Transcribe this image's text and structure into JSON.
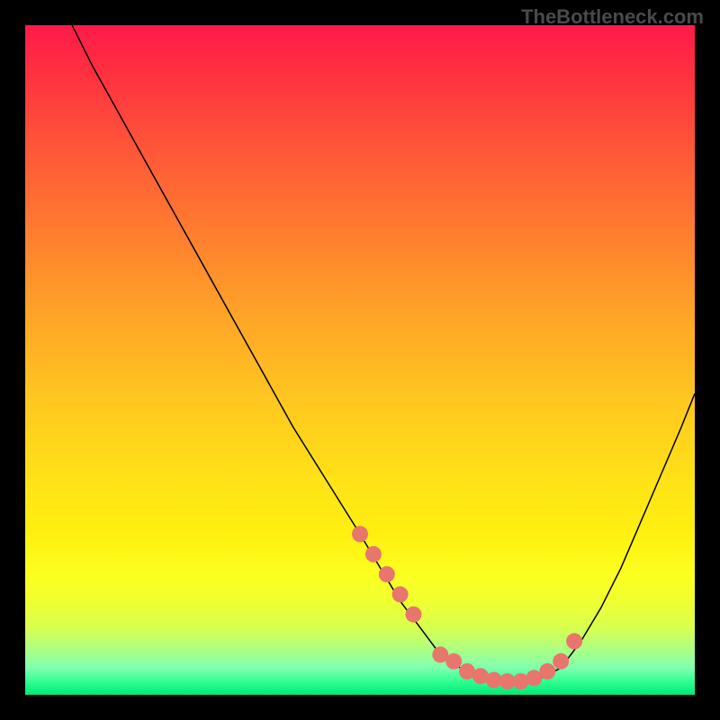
{
  "watermark": "TheBottleneck.com",
  "chart_data": {
    "type": "line",
    "title": "",
    "xlabel": "",
    "ylabel": "",
    "xlim": [
      0,
      100
    ],
    "ylim": [
      0,
      100
    ],
    "series": [
      {
        "name": "curve",
        "x": [
          7,
          10,
          15,
          20,
          25,
          30,
          35,
          40,
          45,
          50,
          53,
          56,
          59,
          62,
          65,
          68,
          71,
          74,
          77,
          80,
          83,
          86,
          89,
          92,
          95,
          98,
          100
        ],
        "y": [
          100,
          94,
          85,
          76,
          67,
          58,
          49,
          40,
          32,
          24,
          19,
          14,
          10,
          6,
          4,
          2.5,
          2,
          2,
          2.5,
          4,
          8,
          13,
          19,
          26,
          33,
          40,
          45
        ]
      }
    ],
    "markers": {
      "name": "highlighted-points",
      "color": "#e8766c",
      "x": [
        50,
        52,
        54,
        56,
        58,
        62,
        64,
        66,
        68,
        70,
        72,
        74,
        76,
        78,
        80,
        82
      ],
      "y": [
        24,
        21,
        18,
        15,
        12,
        6,
        5,
        3.5,
        2.8,
        2.2,
        2,
        2,
        2.5,
        3.5,
        5,
        8
      ]
    },
    "background": {
      "type": "vertical-gradient",
      "stops": [
        {
          "pos": 0,
          "color": "#ff1a4a"
        },
        {
          "pos": 0.5,
          "color": "#ffc420"
        },
        {
          "pos": 0.85,
          "color": "#f0ff30"
        },
        {
          "pos": 1.0,
          "color": "#00e878"
        }
      ]
    }
  }
}
